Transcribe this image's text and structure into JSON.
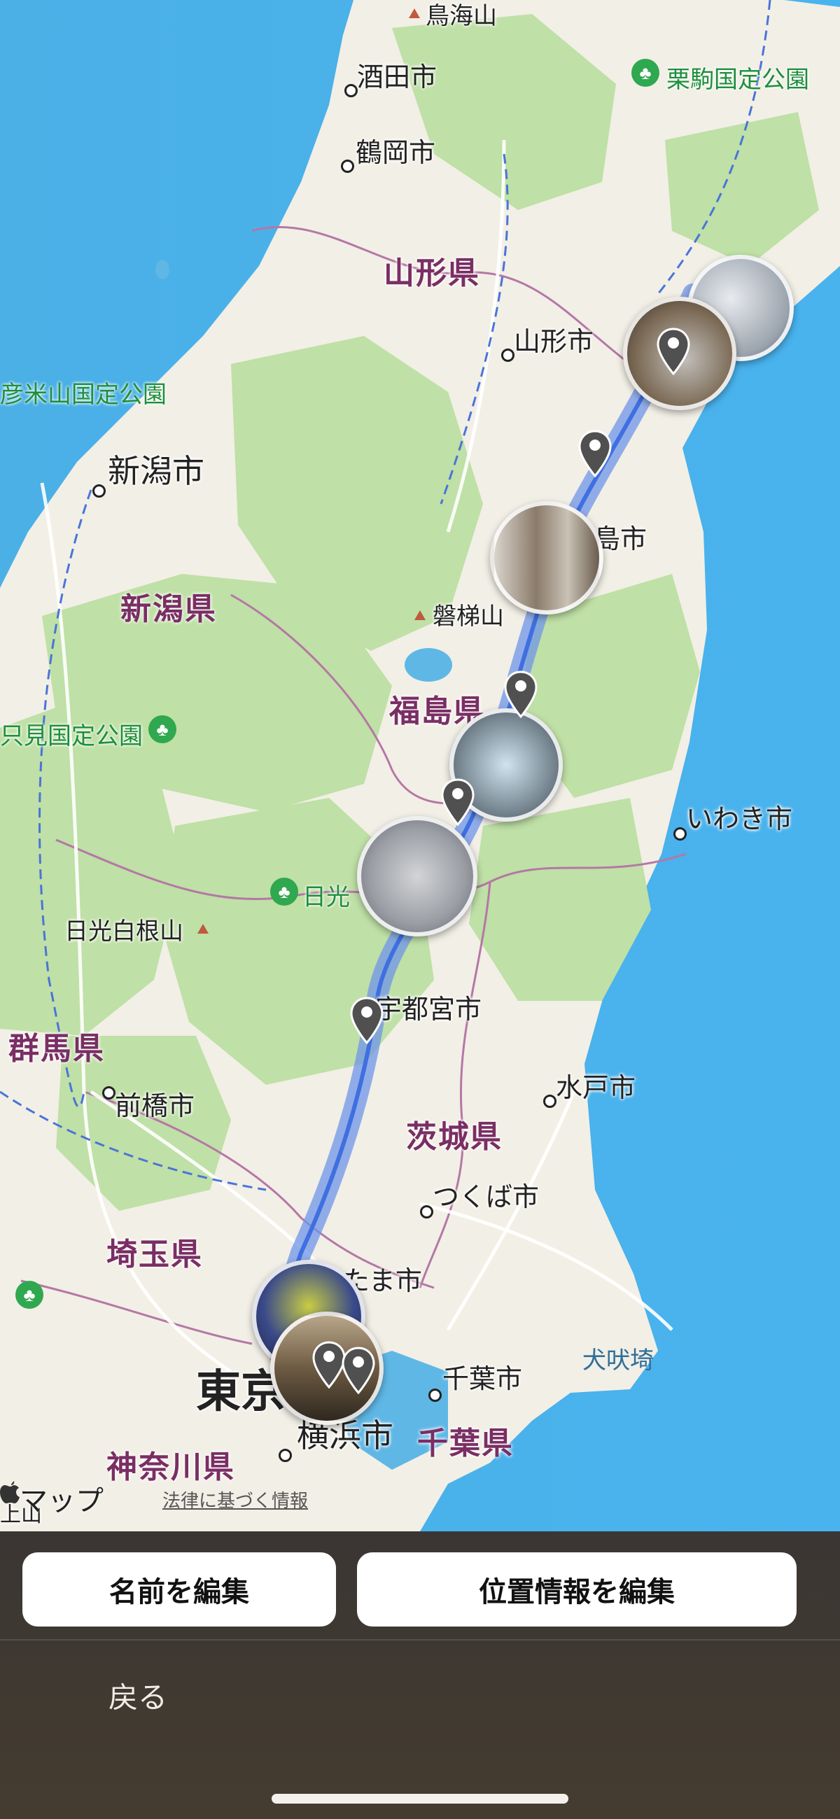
{
  "map": {
    "cities": [
      {
        "id": "sakata",
        "label": "酒田市"
      },
      {
        "id": "tsuruoka",
        "label": "鶴岡市"
      },
      {
        "id": "yamagata",
        "label": "山形市"
      },
      {
        "id": "niigata",
        "label": "新潟市"
      },
      {
        "id": "fukushima",
        "label": "島市"
      },
      {
        "id": "iwaki",
        "label": "いわき市"
      },
      {
        "id": "utsunomiya",
        "label": "宇都宮市"
      },
      {
        "id": "maebashi",
        "label": "前橋市"
      },
      {
        "id": "mito",
        "label": "水戸市"
      },
      {
        "id": "tsukuba",
        "label": "つくば市"
      },
      {
        "id": "saitama",
        "label": "たま市"
      },
      {
        "id": "chiba",
        "label": "千葉市"
      },
      {
        "id": "yokohama",
        "label": "横浜市"
      },
      {
        "id": "tokyo",
        "label": "東京"
      }
    ],
    "prefectures": [
      {
        "id": "yamagata",
        "label": "山形県"
      },
      {
        "id": "niigata",
        "label": "新潟県"
      },
      {
        "id": "fukushima",
        "label": "福島県"
      },
      {
        "id": "gunma",
        "label": "群馬県"
      },
      {
        "id": "ibaraki",
        "label": "茨城県"
      },
      {
        "id": "saitama",
        "label": "埼玉県"
      },
      {
        "id": "kanagawa",
        "label": "神奈川県"
      },
      {
        "id": "chiba",
        "label": "千葉県"
      }
    ],
    "parks": [
      {
        "id": "kurikoma",
        "label": "栗駒国定公園"
      },
      {
        "id": "yonezan",
        "label": "彦米山国定公園"
      },
      {
        "id": "tadami",
        "label": "只見国定公園"
      },
      {
        "id": "nikko",
        "label": "日光"
      }
    ],
    "mountains": [
      {
        "id": "chokai",
        "label": "鳥海山"
      },
      {
        "id": "bandai",
        "label": "磐梯山"
      },
      {
        "id": "nikko_shirane",
        "label": "日光白根山"
      }
    ],
    "sea_labels": [
      {
        "id": "inubosaki",
        "label": "犬吠埼"
      }
    ],
    "edge_label": "上山",
    "attribution": {
      "brand": "マップ",
      "legal": "法律に基づく情報"
    }
  },
  "actions": {
    "edit_name": "名前を編集",
    "edit_location": "位置情報を編集",
    "back": "戻る"
  },
  "colors": {
    "land": "#f2efe6",
    "forest": "#bfe0a6",
    "sea": "#5fb7e6",
    "route": "#6f95e8",
    "pref_label": "#7a2e64",
    "park_label": "#1d8f3c"
  }
}
